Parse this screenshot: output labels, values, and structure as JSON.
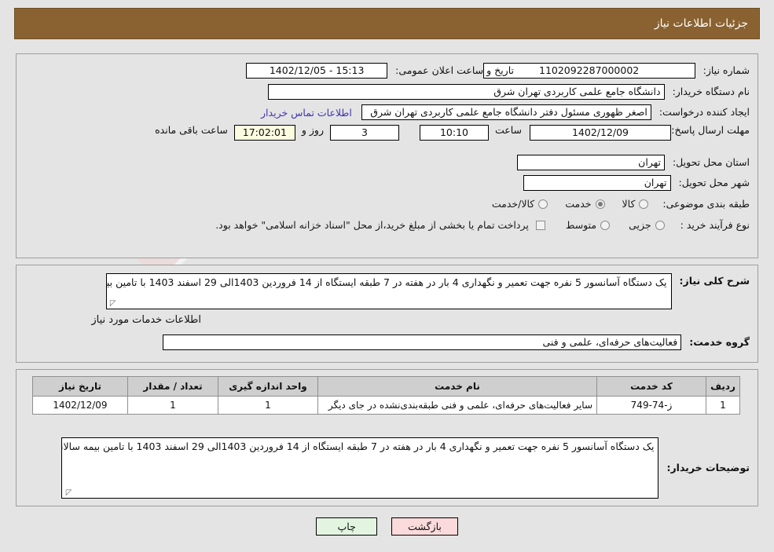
{
  "header": {
    "title": "جزئیات اطلاعات نیاز"
  },
  "fields": {
    "need_number_label": "شماره نیاز:",
    "need_number_value": "1102092287000002",
    "public_announce_label": "تاریخ و ساعت اعلان عمومی:",
    "public_announce_value": "15:13 - 1402/12/05",
    "buyer_org_label": "نام دستگاه خریدار:",
    "buyer_org_value": "دانشگاه جامع علمی کاربردی تهران شرق",
    "requester_label": "ایجاد کننده درخواست:",
    "requester_value": "اصغر ظهوری مسئول دفتر دانشگاه جامع علمی کاربردی تهران شرق",
    "contact_link": "اطلاعات تماس خریدار",
    "deadline_label": "مهلت ارسال پاسخ: تا تاریخ:",
    "deadline_date": "1402/12/09",
    "hour_label": "ساعت",
    "hour_value": "10:10",
    "days_value": "3",
    "days_label": "روز و",
    "remaining_time": "17:02:01",
    "remaining_label": "ساعت باقی مانده",
    "province_label": "استان محل تحویل:",
    "province_value": "تهران",
    "city_label": "شهر محل تحویل:",
    "city_value": "تهران",
    "classification_label": "طبقه بندی موضوعی:",
    "classification_options": [
      "کالا",
      "خدمت",
      "کالا/خدمت"
    ],
    "classification_selected": "خدمت",
    "purchase_type_label": "نوع فرآیند خرید :",
    "purchase_type_options": [
      "جزیی",
      "متوسط"
    ],
    "purchase_type_selected": "",
    "treasury_note": "پرداخت تمام یا بخشی از مبلغ خرید،از محل \"اسناد خزانه اسلامی\" خواهد بود.",
    "treasury_checked": false
  },
  "description": {
    "label": "شرح کلی نیاز:",
    "value": "یک دستگاه آسانسور 5 نفره جهت تعمیر و نگهداری 4 بار در هفته در 7 طبقه ایستگاه از 14 فروردین 1403الی 29 اسفند 1403 با تامین بیمه سالانه آسانسور"
  },
  "services_section": {
    "heading": "اطلاعات خدمات مورد نیاز",
    "group_label": "گروه خدمت:",
    "group_value": "فعالیت‌های حرفه‌ای، علمی و فنی"
  },
  "table": {
    "headers": [
      "ردیف",
      "کد خدمت",
      "نام خدمت",
      "واحد اندازه گیری",
      "تعداد / مقدار",
      "تاریخ نیاز"
    ],
    "rows": [
      {
        "row": "1",
        "code": "ز-74-749",
        "name": "سایر فعالیت‌های حرفه‌ای، علمی و فنی طبقه‌بندی‌نشده در جای دیگر",
        "unit": "1",
        "quantity": "1",
        "need_date": "1402/12/09"
      }
    ]
  },
  "buyer_notes": {
    "label": "توضیحات خریدار:",
    "value": "یک دستگاه آسانسور 5 نفره جهت تعمیر و نگهداری 4 بار در هفته در 7 طبقه ایستگاه از 14 فروردین 1403الی 29 اسفند 1403 با تامین بیمه سالانه آسانسور"
  },
  "buttons": {
    "print": "چاپ",
    "back": "بازگشت"
  },
  "watermark": {
    "text": "AriaTender.net"
  },
  "colors": {
    "header_bg": "#8a6231",
    "page_bg": "#e4e4e4",
    "link": "#4033b5",
    "print_btn": "#e3f5e1",
    "back_btn": "#fadada"
  }
}
